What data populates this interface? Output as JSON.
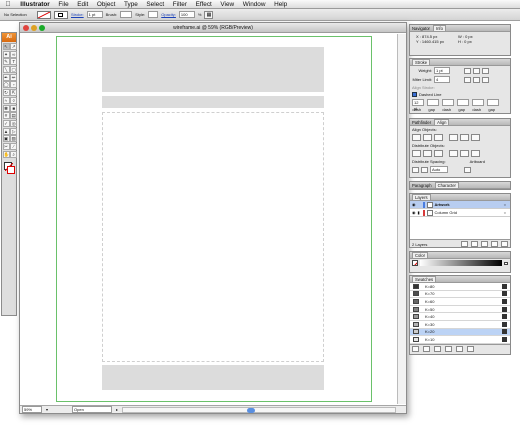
{
  "menubar": {
    "items": [
      {
        "label": "Illustrator",
        "app": true
      },
      {
        "label": "File"
      },
      {
        "label": "Edit"
      },
      {
        "label": "Object"
      },
      {
        "label": "Type"
      },
      {
        "label": "Select"
      },
      {
        "label": "Filter"
      },
      {
        "label": "Effect"
      },
      {
        "label": "View"
      },
      {
        "label": "Window"
      },
      {
        "label": "Help"
      }
    ]
  },
  "control": {
    "selection": "No Selection",
    "stroke_label": "Stroke:",
    "stroke_value": "1 pt",
    "brush_label": "Brush:",
    "style_label": "Style:",
    "opacity_label": "Opacity:",
    "opacity_value": "100",
    "opacity_unit": "%"
  },
  "toolbox": {
    "header": "Ai",
    "tools": [
      "arrow-icon",
      "direct-select-icon",
      "magic-wand-icon",
      "lasso-icon",
      "pen-icon",
      "type-icon",
      "line-icon",
      "rectangle-icon",
      "paintbrush-icon",
      "pencil-icon",
      "blob-icon",
      "eraser-icon",
      "rotate-icon",
      "scale-icon",
      "warp-icon",
      "free-transform-icon",
      "symbol-sprayer-icon",
      "column-graph-icon",
      "mesh-icon",
      "gradient-icon",
      "eyedropper-icon",
      "blend-icon",
      "live-paint-icon",
      "live-paint-select-icon",
      "crop-icon",
      "slice-icon",
      "scissors-icon",
      "knife-icon",
      "hand-icon",
      "zoom-icon"
    ]
  },
  "document": {
    "title": "wireframe.ai @ 59% (RGB/Preview)",
    "zoom": "59%",
    "status_text": "Open"
  },
  "navigator": {
    "tabs": [
      "Navigator",
      "Info"
    ],
    "x": "X : 874.5 px",
    "y": "Y : 1460.415 px",
    "w": "W : 0 px",
    "h": "H : 0 px"
  },
  "stroke": {
    "tab": "Stroke",
    "weight_label": "Weight:",
    "weight_value": "1 pt",
    "miter_label": "Miter Limit:",
    "miter_value": "4",
    "align_label": "Align Stroke:",
    "dashed_label": "Dashed Line",
    "dash_value": "12 pt",
    "dash_labels": [
      "dash",
      "gap",
      "dash",
      "gap",
      "dash",
      "gap"
    ]
  },
  "align": {
    "tabs": [
      "Pathfinder",
      "Align"
    ],
    "align_objects": "Align Objects:",
    "distribute_objects": "Distribute Objects:",
    "distribute_spacing": "Distribute Spacing:",
    "artboard": "Artboard",
    "spacing_value": "Auto"
  },
  "character": {
    "tabs": [
      "Paragraph",
      "Character"
    ]
  },
  "layers": {
    "tab": "Layers",
    "rows": [
      {
        "name": "Artwork",
        "color": "#4a7de0",
        "selected": true
      },
      {
        "name": "Column Grid",
        "color": "#d83a3a",
        "selected": false
      }
    ],
    "count": "2 Layers"
  },
  "color": {
    "tab": "Color"
  },
  "swatches": {
    "tab": "Swatches",
    "items": [
      {
        "name": "K=80",
        "hex": "#333333"
      },
      {
        "name": "K=70",
        "hex": "#4d4d4d"
      },
      {
        "name": "K=60",
        "hex": "#666666"
      },
      {
        "name": "K=50",
        "hex": "#808080"
      },
      {
        "name": "K=40",
        "hex": "#999999"
      },
      {
        "name": "K=30",
        "hex": "#b3b3b3"
      },
      {
        "name": "K=20",
        "hex": "#cccccc"
      },
      {
        "name": "K=10",
        "hex": "#e6e6e6"
      }
    ],
    "selected_index": 6
  }
}
